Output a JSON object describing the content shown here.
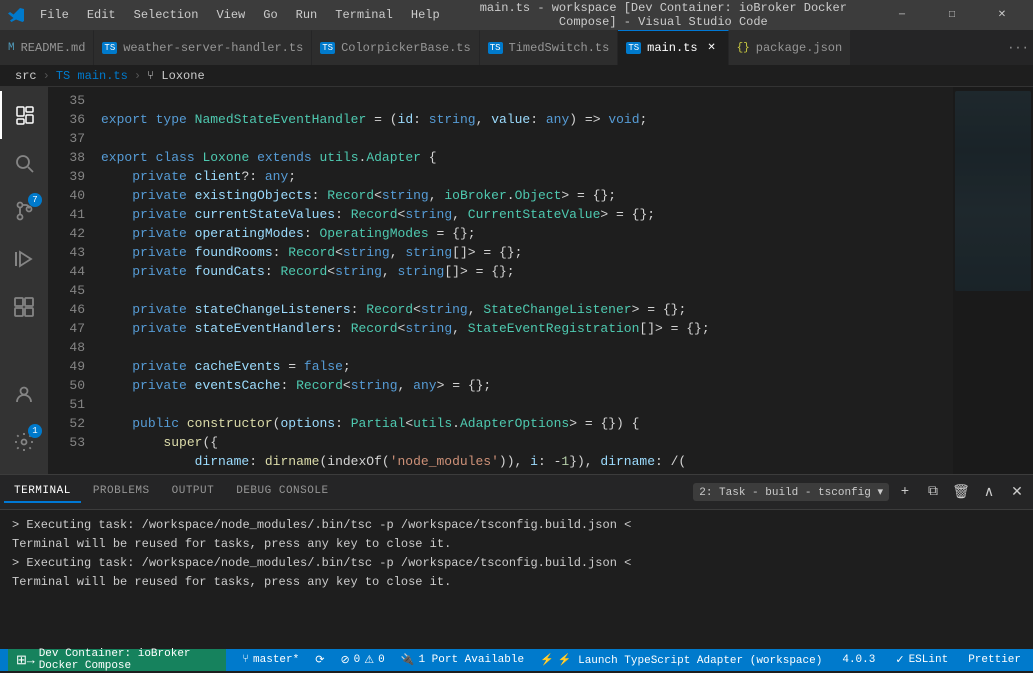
{
  "titleBar": {
    "title": "main.ts - workspace [Dev Container: ioBroker Docker Compose] - Visual Studio Code",
    "menuItems": [
      "File",
      "Edit",
      "Selection",
      "View",
      "Go",
      "Run",
      "Terminal",
      "Help"
    ],
    "windowControls": {
      "minimize": "─",
      "maximize": "□",
      "close": "✕"
    }
  },
  "tabs": [
    {
      "id": "readme",
      "icon": "M",
      "iconColor": "#519aba",
      "label": "README.md",
      "active": false,
      "modified": false
    },
    {
      "id": "weather",
      "icon": "TS",
      "iconColor": "#007acc",
      "label": "weather-server-handler.ts",
      "active": false,
      "modified": false
    },
    {
      "id": "colorpicker",
      "icon": "TS",
      "iconColor": "#007acc",
      "label": "ColorpickerBase.ts",
      "active": false,
      "modified": false
    },
    {
      "id": "timedswitch",
      "icon": "TS",
      "iconColor": "#007acc",
      "label": "TimedSwitch.ts",
      "active": false,
      "modified": false
    },
    {
      "id": "main",
      "icon": "TS",
      "iconColor": "#007acc",
      "label": "main.ts",
      "active": true,
      "modified": false
    },
    {
      "id": "package",
      "icon": "{ }",
      "iconColor": "#cbcb41",
      "label": "package.json",
      "active": false,
      "modified": false
    }
  ],
  "breadcrumb": {
    "parts": [
      "src",
      "TS main.ts",
      "🔀 Loxone"
    ]
  },
  "activityBar": {
    "items": [
      {
        "id": "explorer",
        "icon": "⊞",
        "active": true,
        "badge": null
      },
      {
        "id": "search",
        "icon": "🔍",
        "active": false,
        "badge": null
      },
      {
        "id": "source-control",
        "icon": "⑂",
        "active": false,
        "badge": "7"
      },
      {
        "id": "run",
        "icon": "▷",
        "active": false,
        "badge": null
      },
      {
        "id": "extensions",
        "icon": "⊞",
        "active": false,
        "badge": null
      }
    ],
    "bottomItems": [
      {
        "id": "remote",
        "icon": "⚙",
        "active": false
      },
      {
        "id": "accounts",
        "icon": "👤",
        "active": false
      },
      {
        "id": "settings",
        "icon": "⚙",
        "active": false,
        "badge": "1"
      }
    ]
  },
  "editor": {
    "lines": [
      {
        "num": 35,
        "content": "<span class='kw'>export</span> <span class='kw'>type</span> <span class='type'>NamedStateEventHandler</span> <span class='op'>=</span> <span class='op'>(</span><span class='prop'>id</span><span class='op'>:</span> <span class='kw'>string</span><span class='op'>,</span> <span class='prop'>value</span><span class='op'>:</span> <span class='kw'>any</span><span class='op'>)</span> <span class='op'>=></span> <span class='kw'>void</span><span class='op'>;</span>"
      },
      {
        "num": 36,
        "content": ""
      },
      {
        "num": 37,
        "content": "<span class='kw'>export</span> <span class='kw'>class</span> <span class='cls'>Loxone</span> <span class='kw'>extends</span> <span class='ns'>utils</span><span class='op'>.</span><span class='cls'>Adapter</span> <span class='op'>{</span>"
      },
      {
        "num": 38,
        "content": "    <span class='kw'>private</span> <span class='prop'>client</span><span class='op'>?:</span> <span class='kw'>any</span><span class='op'>;</span>"
      },
      {
        "num": 39,
        "content": "    <span class='kw'>private</span> <span class='prop'>existingObjects</span><span class='op'>:</span> <span class='type'>Record</span><span class='op'>&lt;</span><span class='kw'>string</span><span class='op'>,</span> <span class='ns'>ioBroker</span><span class='op'>.</span><span class='type'>Object</span><span class='op'>&gt;</span> <span class='op'>=</span> <span class='op'>{};</span>"
      },
      {
        "num": 40,
        "content": "    <span class='kw'>private</span> <span class='prop'>currentStateValues</span><span class='op'>:</span> <span class='type'>Record</span><span class='op'>&lt;</span><span class='kw'>string</span><span class='op'>,</span> <span class='type'>CurrentStateValue</span><span class='op'>&gt;</span> <span class='op'>=</span> <span class='op'>{};</span>"
      },
      {
        "num": 41,
        "content": "    <span class='kw'>private</span> <span class='prop'>operatingModes</span><span class='op'>:</span> <span class='type'>OperatingModes</span> <span class='op'>=</span> <span class='op'>{};</span>"
      },
      {
        "num": 42,
        "content": "    <span class='kw'>private</span> <span class='prop'>foundRooms</span><span class='op'>:</span> <span class='type'>Record</span><span class='op'>&lt;</span><span class='kw'>string</span><span class='op'>,</span> <span class='kw'>string</span><span class='op'>[]&gt;</span> <span class='op'>=</span> <span class='op'>{};</span>"
      },
      {
        "num": 43,
        "content": "    <span class='kw'>private</span> <span class='prop'>foundCats</span><span class='op'>:</span> <span class='type'>Record</span><span class='op'>&lt;</span><span class='kw'>string</span><span class='op'>,</span> <span class='kw'>string</span><span class='op'>[]&gt;</span> <span class='op'>=</span> <span class='op'>{};</span>"
      },
      {
        "num": 44,
        "content": ""
      },
      {
        "num": 45,
        "content": "    <span class='kw'>private</span> <span class='prop'>stateChangeListeners</span><span class='op'>:</span> <span class='type'>Record</span><span class='op'>&lt;</span><span class='kw'>string</span><span class='op'>,</span> <span class='type'>StateChangeListener</span><span class='op'>&gt;</span> <span class='op'>=</span> <span class='op'>{};</span>"
      },
      {
        "num": 46,
        "content": "    <span class='kw'>private</span> <span class='prop'>stateEventHandlers</span><span class='op'>:</span> <span class='type'>Record</span><span class='op'>&lt;</span><span class='kw'>string</span><span class='op'>,</span> <span class='type'>StateEventRegistration</span><span class='op'>[]&gt;</span> <span class='op'>=</span> <span class='op'>{};</span>"
      },
      {
        "num": 47,
        "content": ""
      },
      {
        "num": 48,
        "content": "    <span class='kw'>private</span> <span class='prop'>cacheEvents</span> <span class='op'>=</span> <span class='kw'>false</span><span class='op'>;</span>"
      },
      {
        "num": 49,
        "content": "    <span class='kw'>private</span> <span class='prop'>eventsCache</span><span class='op'>:</span> <span class='type'>Record</span><span class='op'>&lt;</span><span class='kw'>string</span><span class='op'>,</span> <span class='kw'>any</span><span class='op'>&gt;</span> <span class='op'>=</span> <span class='op'>{};</span>"
      },
      {
        "num": 50,
        "content": ""
      },
      {
        "num": 51,
        "content": "    <span class='kw'>public</span> <span class='func'>constructor</span><span class='op'>(</span><span class='prop'>options</span><span class='op'>:</span> <span class='type'>Partial</span><span class='op'>&lt;</span><span class='ns'>utils</span><span class='op'>.</span><span class='type'>AdapterOptions</span><span class='op'>&gt;</span> <span class='op'>=</span> <span class='op'>{})</span> <span class='op'>{</span>"
      },
      {
        "num": 52,
        "content": "        <span class='func'>super</span><span class='op'>({</span>"
      },
      {
        "num": 53,
        "content": "            <span class='prop'>dirname</span><span class='op'>:</span> <span class='func'>dirname</span><span class='op'>(</span><span class='prop'>indexOf</span><span class='op'>(</span><span class='string'>'node_modules'</span><span class='op'>)),</span> <span class='prop'>i</span><span class='op'>:</span> <span class='op'>-</span><span class='num'>1</span><span class='op'>}),</span> <span class='prop'>dirname</span><span class='op'>:</span> <span class='op'>/(</span>"
      }
    ]
  },
  "terminalPanel": {
    "tabs": [
      {
        "id": "terminal",
        "label": "TERMINAL",
        "active": true
      },
      {
        "id": "problems",
        "label": "PROBLEMS",
        "active": false
      },
      {
        "id": "output",
        "label": "OUTPUT",
        "active": false
      },
      {
        "id": "debug-console",
        "label": "DEBUG CONSOLE",
        "active": false
      }
    ],
    "activeTerminal": "2: Task - build - tsconfig ▾",
    "lines": [
      "> Executing task: /workspace/node_modules/.bin/tsc -p /workspace/tsconfig.build.json <",
      "",
      "Terminal will be reused for tasks, press any key to close it.",
      "",
      "> Executing task: /workspace/node_modules/.bin/tsc -p /workspace/tsconfig.build.json <",
      "",
      "Terminal will be reused for tasks, press any key to close it."
    ]
  },
  "statusBar": {
    "remote": "Dev Container: ioBroker Docker Compose",
    "branch": "master*",
    "sync": "⟳",
    "errors": "⊘ 0",
    "warnings": "⚠ 0",
    "ports": "🔌 1 Port Available",
    "launch": "⚡ Launch TypeScript Adapter (workspace)",
    "version": "4.0.3",
    "linting": "✓ ESLint",
    "formatter": "Prettier"
  }
}
